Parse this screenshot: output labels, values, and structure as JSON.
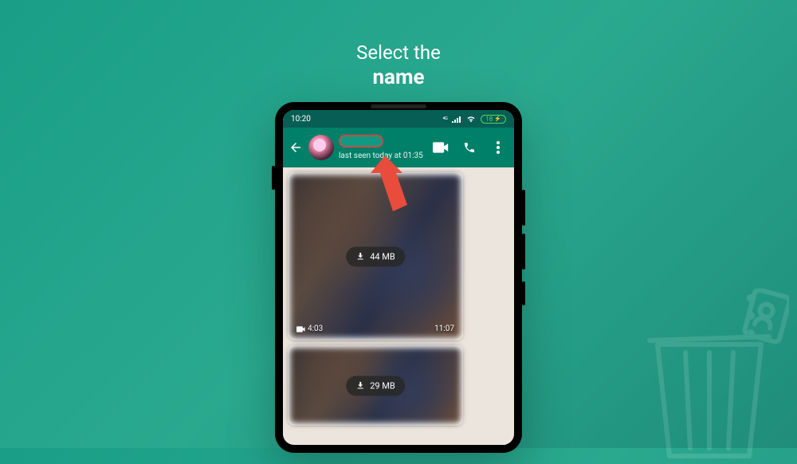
{
  "headline": {
    "line1": "Select the",
    "line2": "name"
  },
  "status": {
    "time": "10:20",
    "battery": "18"
  },
  "chat": {
    "header": {
      "last_seen": "last seen today at 01:35"
    },
    "messages": [
      {
        "download_size": "44 MB",
        "duration": "4:03",
        "time": "11:07"
      },
      {
        "download_size": "29 MB"
      }
    ]
  }
}
